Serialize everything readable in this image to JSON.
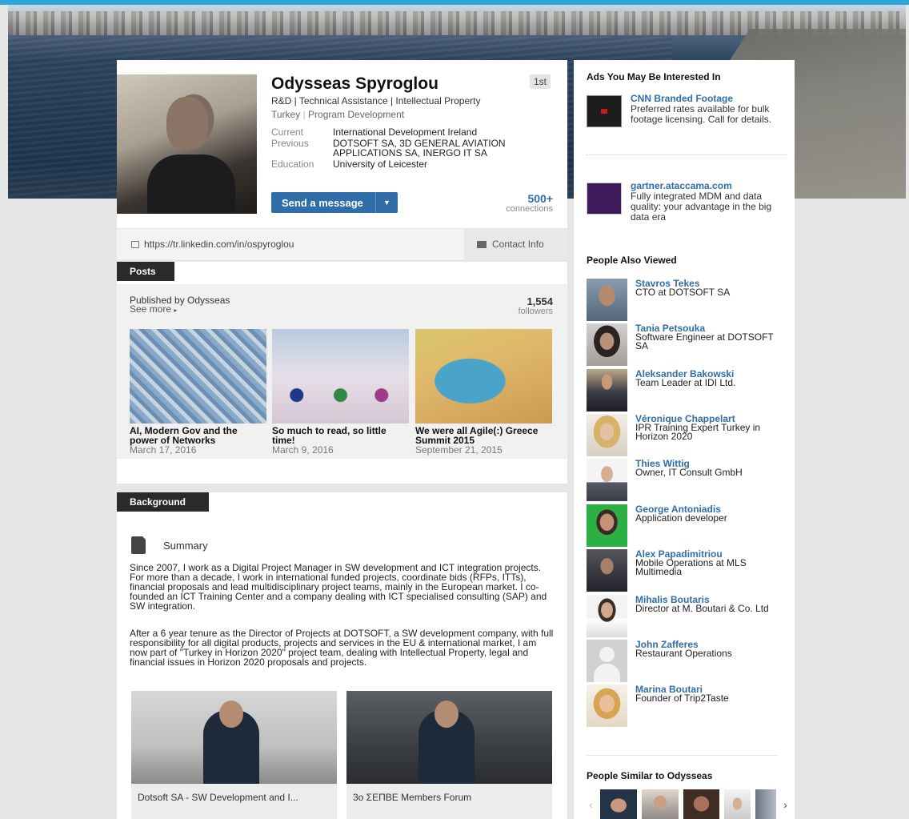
{
  "profile": {
    "name": "Odysseas Spyroglou",
    "degree": "1st",
    "headline": "R&D | Technical Assistance | Intellectual Property",
    "location": "Turkey",
    "industry": "Program Development",
    "facts": [
      {
        "key": "Current",
        "value": "International Development Ireland"
      },
      {
        "key": "Previous",
        "value": "DOTSOFT SA, 3D GENERAL AVIATION APPLICATIONS SA, INERGO IT SA"
      },
      {
        "key": "Education",
        "value": "University of Leicester"
      }
    ],
    "send_message_label": "Send a message",
    "connections_count": "500+",
    "connections_label": "connections",
    "public_url": "https://tr.linkedin.com/in/ospyroglou",
    "contact_info_label": "Contact Info"
  },
  "posts": {
    "tab_label": "Posts",
    "published_by": "Published by Odysseas",
    "see_more": "See more",
    "followers_count": "1,554",
    "followers_label": "followers",
    "items": [
      {
        "title": "AI, Modern Gov and the power of Networks",
        "date": "March 17, 2016"
      },
      {
        "title": "So much to read, so little time!",
        "date": "March 9, 2016"
      },
      {
        "title": "We were all Agile(:) Greece Summit 2015",
        "date": "September 21, 2015"
      }
    ]
  },
  "background": {
    "tab_label": "Background",
    "summary_label": "Summary",
    "paragraphs": [
      "Since 2007, I work as a Digital Project Manager in SW development and ICT integration projects. For more than a decade, I work in international funded projects, coordinate bids (RFPs, ITTs), financial proposals and lead multidisciplinary project teams, mainly in the European market. I co-founded an ICT Training Center and a company dealing with ICT specialised consulting (SAP) and SW integration.",
      "After a 6 year tenure as the Director of Projects at DOTSOFT, a SW development company, with full responsibility for all digital products, projects and services in the EU & international market, I am now part of \"Turkey in Horizon 2020\" project team, dealing with Intellectual Property, legal and financial issues in Horizon 2020 proposals and projects."
    ],
    "media": [
      {
        "caption": "Dotsoft SA - SW Development and I..."
      },
      {
        "caption": "3o ΣΕΠΒΕ Members Forum"
      }
    ]
  },
  "ads": {
    "title": "Ads You May Be Interested In",
    "items": [
      {
        "heading": "CNN Branded Footage",
        "body": "Preferred rates available for bulk footage licensing. Call for details."
      },
      {
        "heading": "gartner.ataccama.com",
        "body": "Fully integrated MDM and data quality: your advantage in the big data era"
      }
    ]
  },
  "people_also_viewed": {
    "title": "People Also Viewed",
    "items": [
      {
        "name": "Stavros Tekes",
        "title": "CTO at DOTSOFT SA"
      },
      {
        "name": "Tania Petsouka",
        "title": "Software Engineer at DOTSOFT SA"
      },
      {
        "name": "Aleksander Bakowski",
        "title": "Team Leader at IDI Ltd."
      },
      {
        "name": "Véronique Chappelart",
        "title": "IPR Training Expert Turkey in Horizon 2020"
      },
      {
        "name": "Thies Wittig",
        "title": "Owner, IT Consult GmbH"
      },
      {
        "name": "George Antoniadis",
        "title": "Application developer"
      },
      {
        "name": "Alex Papadimitriou",
        "title": "Mobile Operations at MLS Multimedia"
      },
      {
        "name": "Mihalis Boutaris",
        "title": "Director at M. Boutari & Co. Ltd"
      },
      {
        "name": "John Zafferes",
        "title": "Restaurant Operations"
      },
      {
        "name": "Marina Boutari",
        "title": "Founder of Trip2Taste"
      }
    ]
  },
  "people_similar": {
    "title": "People Similar to Odysseas",
    "prev_arrow": "‹",
    "next_arrow": "›"
  },
  "colors": {
    "accent": "#2f6ea8",
    "top_line": "#2ea6d9",
    "tab_dark": "#2a2a2a"
  }
}
